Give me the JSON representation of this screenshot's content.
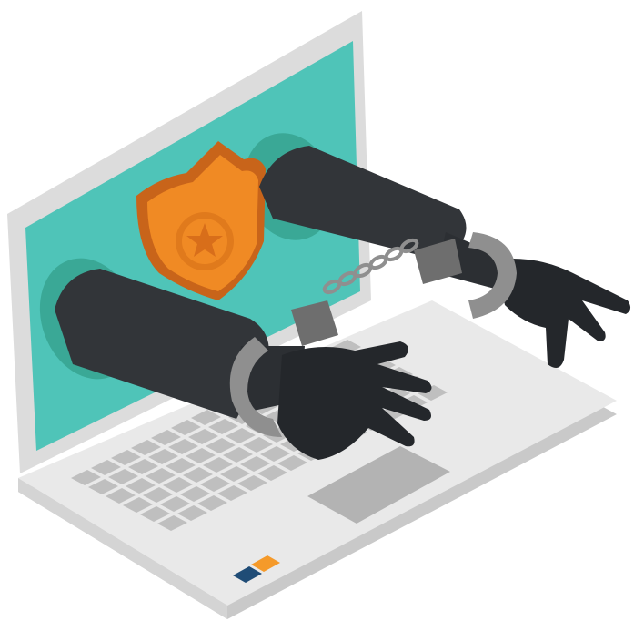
{
  "illustration": {
    "subject": "laptop-handcuffed-arms-police-badge",
    "icons": [
      "laptop-icon",
      "police-badge-icon",
      "handcuffs-icon",
      "arm-icon",
      "hand-icon",
      "keyboard-icon",
      "star-icon"
    ],
    "colors": {
      "laptop_body": "#e6e6e6",
      "laptop_edge": "#c9c9c9",
      "screen": "#4fc4b8",
      "screen_hole": "#3aa896",
      "key": "#bfbfbf",
      "trackpad": "#b3b3b3",
      "sleeve": "#323539",
      "hand": "#24272b",
      "badge": "#f08a24",
      "badge_dark": "#c8641a",
      "cuff": "#8f8f8f",
      "cuff_dark": "#6e6e6e",
      "logo_blue": "#1f4c76",
      "logo_orange": "#f59a2a"
    }
  }
}
